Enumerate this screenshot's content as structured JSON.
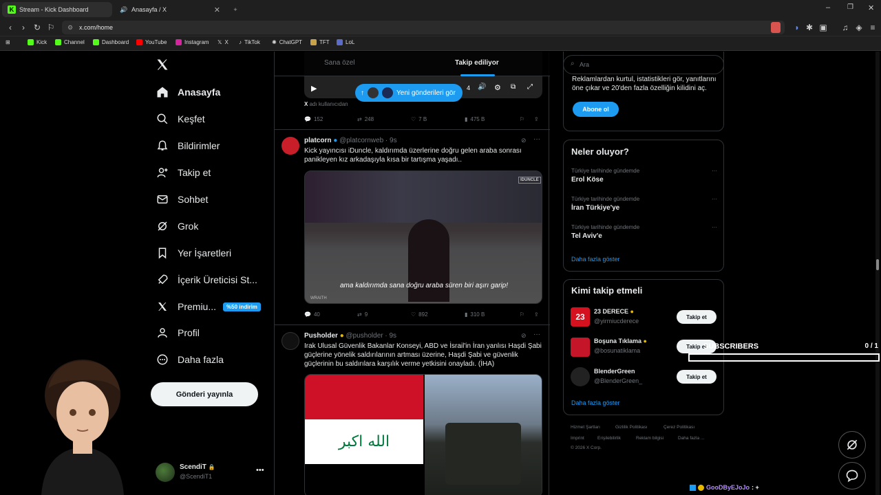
{
  "browser": {
    "tabs": [
      {
        "title": "Stream - Kick Dashboard",
        "active": false
      },
      {
        "title": "Anasayfa / X",
        "active": true
      }
    ],
    "url": "x.com/home",
    "bookmarks": [
      "Kick",
      "Channel",
      "Dashboard",
      "YouTube",
      "Instagram",
      "X",
      "TikTok",
      "ChatGPT",
      "TFT",
      "LoL"
    ]
  },
  "sidebar": {
    "items": [
      {
        "label": "Anasayfa",
        "icon": "home-icon"
      },
      {
        "label": "Keşfet",
        "icon": "search-icon"
      },
      {
        "label": "Bildirimler",
        "icon": "bell-icon"
      },
      {
        "label": "Takip et",
        "icon": "add-user-icon"
      },
      {
        "label": "Sohbet",
        "icon": "mail-icon"
      },
      {
        "label": "Grok",
        "icon": "grok-icon"
      },
      {
        "label": "Yer İşaretleri",
        "icon": "bookmark-icon"
      },
      {
        "label": "İçerik Üreticisi St...",
        "icon": "rocket-icon"
      },
      {
        "label": "Premiu...",
        "icon": "x-logo-icon"
      },
      {
        "label": "Profil",
        "icon": "person-icon"
      },
      {
        "label": "Daha fazla",
        "icon": "more-circle-icon"
      }
    ],
    "premium_badge": "%50 indirim",
    "post_button": "Gönderi yayınla",
    "account": {
      "name": "ScendiT",
      "handle": "@ScendiT1"
    }
  },
  "feed": {
    "tabs": [
      "Sana özel",
      "Takip ediliyor"
    ],
    "new_posts_pill": "Yeni gönderileri gör",
    "top_post": {
      "source": "adı kullanıcıdan",
      "video_time": "4",
      "stats": {
        "replies": "152",
        "reposts": "248",
        "likes": "7 B",
        "views": "475 B"
      }
    },
    "posts": [
      {
        "name": "platcorn",
        "handle": "@platcornweb",
        "time": "9s",
        "text": "Kick yayıncısı iDuncle, kaldırımda üzerlerine doğru gelen araba sonrası panikleyen kız arkadaşıyla kısa bir tartışma yaşadı..",
        "caption": "ama kaldırımda sana doğru araba süren biri aşırı garip!",
        "watermark": "WRAITH",
        "video_logo": "IDUNCLE",
        "stats": {
          "replies": "40",
          "reposts": "9",
          "likes": "892",
          "views": "310 B"
        }
      },
      {
        "name": "Pusholder",
        "handle": "@pusholder",
        "time": "9s",
        "text": "Irak Ulusal Güvenlik Bakanlar Konseyi, ABD ve İsrail'in İran yanlısı Haşdi Şabi güçlerine yönelik saldırılarının artması üzerine, Haşdi Şabi ve güvenlik güçlerinin bu saldırılara karşılık verme yetkisini onayladı. (İHA)",
        "flag_text": "الله اكبر"
      }
    ]
  },
  "right": {
    "search_placeholder": "Ara",
    "premium_text": "Reklamlardan kurtul, istatistikleri gör, yanıtlarını öne çıkar ve 20'den fazla özelliğin kilidini aç.",
    "subscribe_button": "Abone ol",
    "trends_title": "Neler oluyor?",
    "trends": [
      {
        "meta": "Türkiye tarihinde gündemde",
        "name": "Erol Köse"
      },
      {
        "meta": "Türkiye tarihinde gündemde",
        "name": "İran Türkiye'ye"
      },
      {
        "meta": "Türkiye tarihinde gündemde",
        "name": "Tel Aviv'e"
      }
    ],
    "show_more": "Daha fazla göster",
    "wtf_title": "Kimi takip etmeli",
    "wtf": [
      {
        "name": "23 DERECE",
        "handle": "@yirmiucderece",
        "button": "Takip et"
      },
      {
        "name": "Boşuna Tıklama",
        "handle": "@bosunatiklama",
        "button": "Takip et"
      },
      {
        "name": "BlenderGreen",
        "handle": "@BlenderGreen_",
        "button": "Takip et"
      }
    ],
    "footer": [
      "Hizmet Şartları",
      "Gizlilik Politikası",
      "Çerez Politikası",
      "Imprint",
      "Erişilebilirlik",
      "Reklam bilgisi",
      "Daha fazla ...",
      "© 2026 X Corp."
    ]
  },
  "overlay": {
    "subscribers_label": "SUBSCRIBERS",
    "subscribers_count": "0 / 1",
    "chat_ticker": "GooDByEJoJo",
    "chat_ticker_suffix": ": +"
  },
  "colors": {
    "accent": "#1d9bf0",
    "kick": "#53fc18",
    "bg": "#000000",
    "border": "#2f3336"
  }
}
